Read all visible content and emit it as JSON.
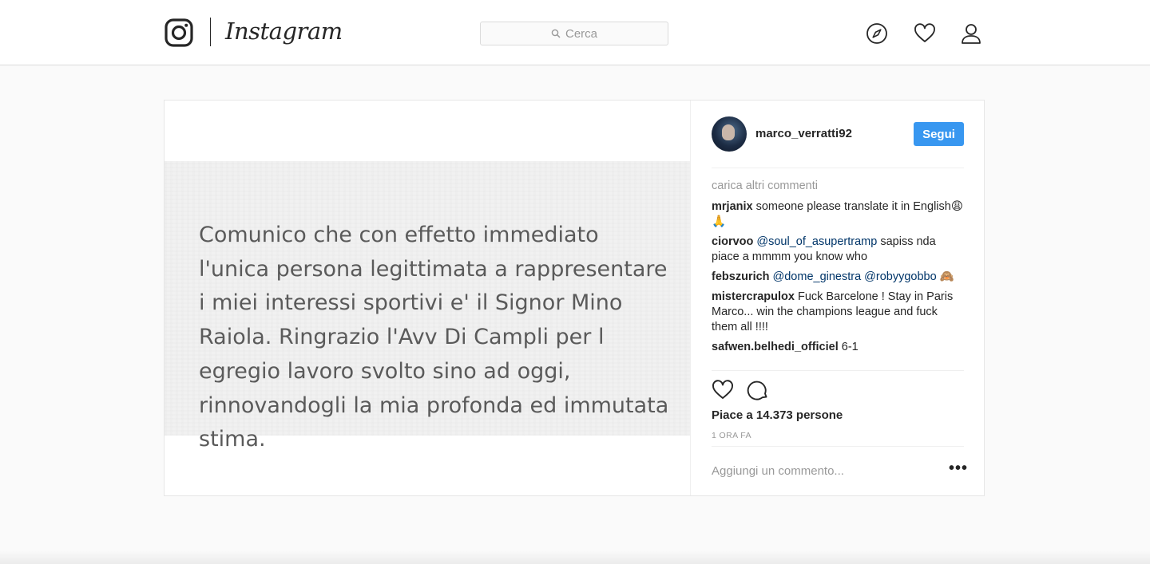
{
  "header": {
    "wordmark": "Instagram",
    "search_placeholder": "Cerca",
    "icons": [
      "instagram-logo-icon",
      "explore-compass-icon",
      "activity-heart-icon",
      "profile-icon"
    ]
  },
  "post": {
    "image_text": "Comunico che con effetto immediato\nl'unica persona legittimata a rappresentare\ni miei interessi sportivi e' il Signor Mino\nRaiola. Ringrazio l'Avv Di Campli per l\negregio lavoro svolto sino ad oggi,\nrinnovandogli la mia profonda ed immutata\nstima.",
    "author": {
      "username": "marco_verratti92",
      "follow_label": "Segui"
    },
    "load_more": "carica altri commenti",
    "comments": [
      {
        "author": "mrjanix",
        "text": "someone please translate it in English😩🙏"
      },
      {
        "author": "ciorvoo",
        "mention": "@soul_of_asupertramp",
        "text": " sapiss nda piace a mmmm you know who"
      },
      {
        "author": "febszurich",
        "mention": "@dome_ginestra @robyygobbo",
        "text": " 🙈"
      },
      {
        "author": "mistercrapulox",
        "text": "Fuck Barcelone ! Stay in Paris Marco... win the champions league and fuck them all !!!!"
      },
      {
        "author": "safwen.belhedi_officiel",
        "text": "6-1"
      }
    ],
    "likes": "Piace a 14.373 persone",
    "time_ago": "1 ORA FA",
    "add_comment_placeholder": "Aggiungi un commento...",
    "more_options": "•••"
  },
  "colors": {
    "accent": "#3897f0",
    "mention": "#003569",
    "muted": "#999999",
    "text": "#262626"
  }
}
